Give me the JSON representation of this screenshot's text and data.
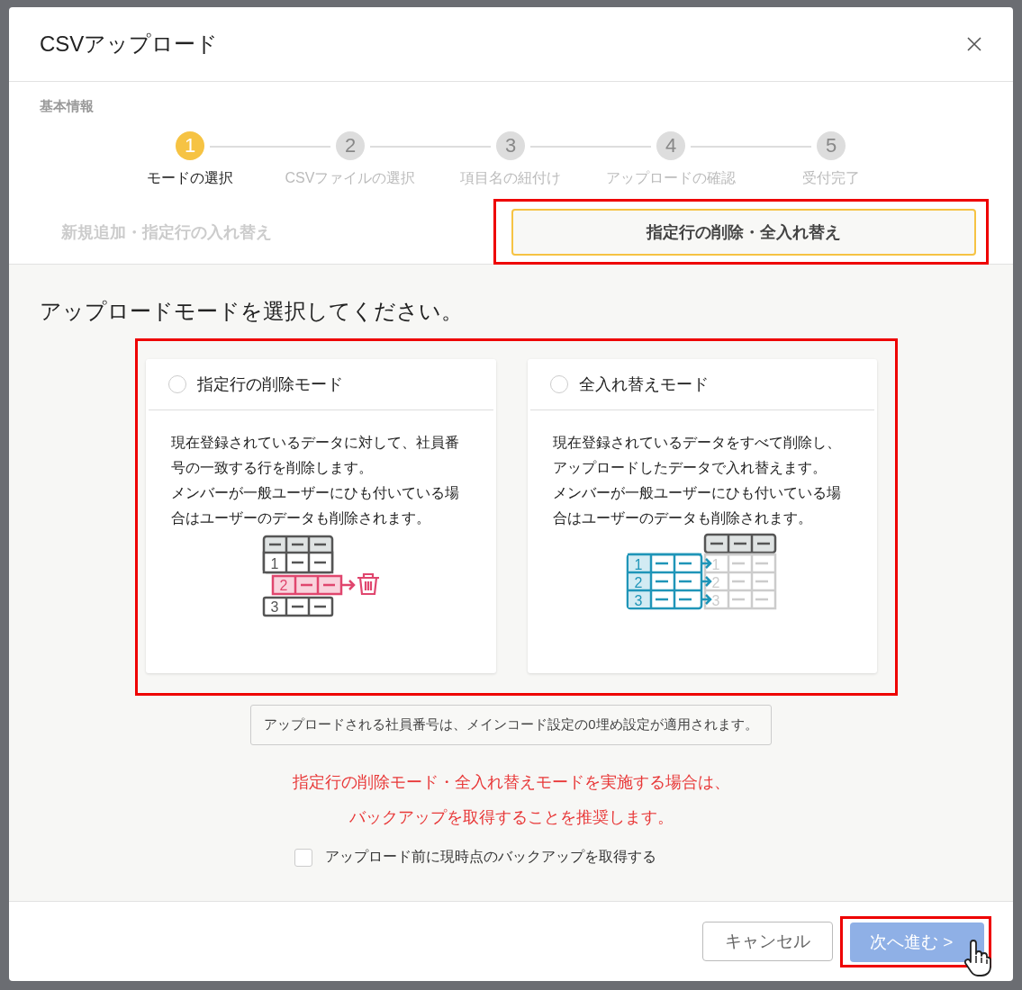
{
  "dialog": {
    "title": "CSVアップロード"
  },
  "section_label": "基本情報",
  "steps": [
    {
      "number": "1",
      "label": "モードの選択",
      "selected": true
    },
    {
      "number": "2",
      "label": "CSVファイルの選択",
      "selected": false
    },
    {
      "number": "3",
      "label": "項目名の紐付け",
      "selected": false
    },
    {
      "number": "4",
      "label": "アップロードの確認",
      "selected": false
    },
    {
      "number": "5",
      "label": "受付完了",
      "selected": false
    }
  ],
  "mode_tabs": [
    {
      "label": "新規追加・指定行の入れ替え",
      "selected": false,
      "highlighted": false
    },
    {
      "label": "指定行の削除・全入れ替え",
      "selected": true,
      "highlighted": true
    }
  ],
  "prompt": "アップロードモードを選択してください。",
  "mode_cards": [
    {
      "kind": "delete",
      "title": "指定行の削除モード",
      "checked": false,
      "description": [
        "現在登録されているデータに対して、社員番号の一致する行を削除します。",
        "メンバーが一般ユーザーにひも付いている場合はユーザーのデータも削除されます。"
      ],
      "rows": [
        "1",
        "2",
        "3"
      ]
    },
    {
      "kind": "replace",
      "title": "全入れ替えモード",
      "checked": false,
      "description": [
        "現在登録されているデータをすべて削除し、アップロードしたデータで入れ替えます。",
        "メンバーが一般ユーザーにひも付いている場合はユーザーのデータも削除されます。"
      ],
      "rows": [
        "1",
        "2",
        "3"
      ],
      "target_rows": [
        "1",
        "2",
        "3"
      ]
    }
  ],
  "notice": "アップロードされる社員番号は、メインコード設定の0埋め設定が適用されます。",
  "warning_lines": [
    "指定行の削除モード・全入れ替えモードを実施する場合は、",
    "バックアップを取得することを推奨します。"
  ],
  "backup_checkbox": {
    "label": "アップロード前に現時点のバックアップを取得する",
    "checked": false
  },
  "buttons": {
    "cancel": {
      "label": "キャンセル"
    },
    "next": {
      "label": "次へ進む >",
      "disabled": true,
      "highlighted": true
    }
  }
}
